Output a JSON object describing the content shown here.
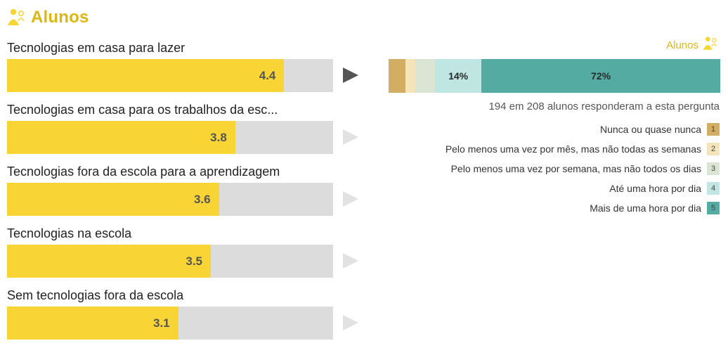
{
  "header": {
    "title": "Alunos",
    "icon": "students-icon",
    "color": "#dcb714"
  },
  "chart_data": [
    {
      "type": "bar",
      "orientation": "horizontal",
      "categories": [
        "Tecnologias em casa para lazer",
        "Tecnologias em casa para os trabalhos da esc...",
        "Tecnologias fora da escola para a aprendizagem",
        "Tecnologias na escola",
        "Sem tecnologias fora da escola"
      ],
      "values": [
        4.4,
        3.8,
        3.6,
        3.5,
        3.1
      ],
      "value_labels": [
        "4.4",
        "3.8",
        "3.6",
        "3.5",
        "3.1"
      ],
      "xlim": [
        1,
        5
      ],
      "selected_index": 0,
      "bar_color": "#f8d535",
      "track_color": "#dcdcdc"
    },
    {
      "type": "bar",
      "stacked": true,
      "orientation": "horizontal",
      "series_label": "Alunos",
      "responded_text": "194 em 208 alunos responderam a esta pergunta",
      "categories": [
        "Nunca ou quase nunca",
        "Pelo menos uma vez por mês, mas não todas as semanas",
        "Pelo menos uma vez por semana, mas não todos os dias",
        "Até uma hora por dia",
        "Mais de uma hora por dia"
      ],
      "codes": [
        "1",
        "2",
        "3",
        "4",
        "5"
      ],
      "values": [
        5,
        3,
        6,
        14,
        72
      ],
      "value_labels": [
        "",
        "",
        "",
        "14%",
        "72%"
      ],
      "colors": [
        "#d3ae62",
        "#f4e4b9",
        "#dbe5d4",
        "#bfe6e2",
        "#53aba1"
      ]
    }
  ]
}
